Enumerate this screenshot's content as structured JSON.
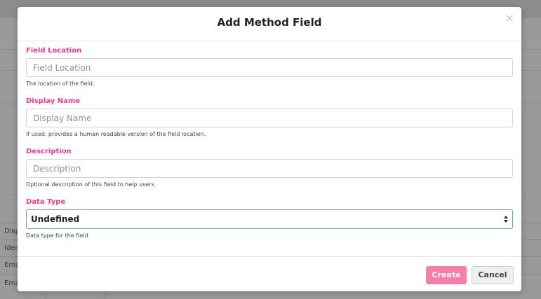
{
  "background": {
    "table_rows": [
      "Disp",
      "Iden",
      "Ema",
      "Ema"
    ]
  },
  "modal": {
    "title": "Add Method Field",
    "close_glyph": "×",
    "fields": [
      {
        "label": "Field Location",
        "placeholder": "Field Location",
        "value": "",
        "help": "The location of the field."
      },
      {
        "label": "Display Name",
        "placeholder": "Display Name",
        "value": "",
        "help": "If used, provides a human readable version of the field location."
      },
      {
        "label": "Description",
        "placeholder": "Description",
        "value": "",
        "help": "Optional description of this field to help users."
      }
    ],
    "data_type": {
      "label": "Data Type",
      "selected": "Undefined",
      "help": "Data type for the field."
    },
    "buttons": {
      "create": "Create",
      "cancel": "Cancel"
    }
  },
  "colors": {
    "label_pink": "#e83e8c",
    "create_button": "#f57fa9",
    "select_focus_border": "#6d9ec6"
  }
}
